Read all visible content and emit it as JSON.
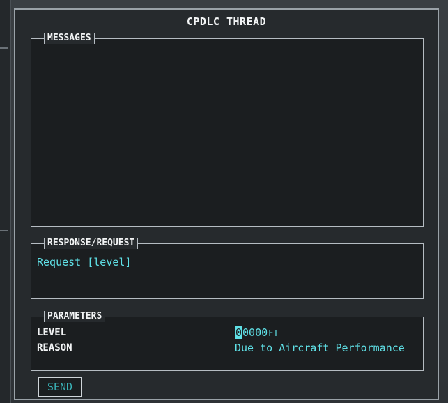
{
  "window": {
    "title": "CPDLC THREAD"
  },
  "messages": {
    "label": "MESSAGES"
  },
  "response": {
    "label": "RESPONSE/REQUEST",
    "text": "Request [level]"
  },
  "parameters": {
    "label": "PARAMETERS",
    "level": {
      "label": "LEVEL",
      "cursor_digit": "0",
      "value_rest": "0000",
      "unit": "FT"
    },
    "reason": {
      "label": "REASON",
      "value": "Due to Aircraft Performance"
    }
  },
  "actions": {
    "send_label": "SEND"
  },
  "colors": {
    "accent": "#5fe0e6",
    "background": "#1b1e20",
    "frame": "#b5bcc2"
  }
}
